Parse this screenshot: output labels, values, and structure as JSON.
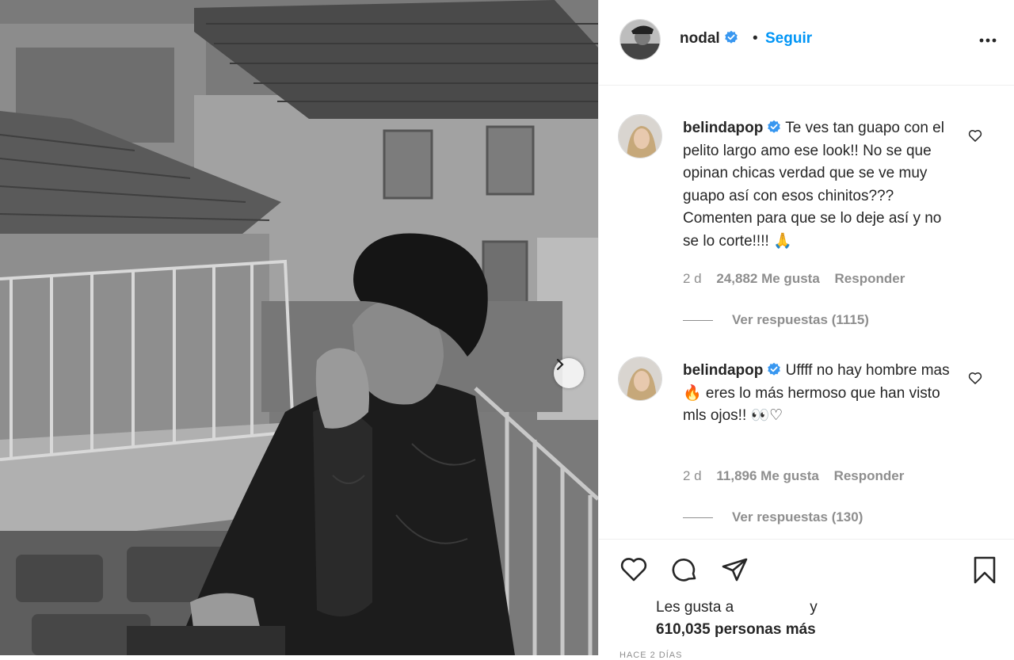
{
  "post": {
    "username": "nodal",
    "separator": "•",
    "follow_label": "Seguir"
  },
  "comments": [
    {
      "username": "belindapop",
      "text": "Te ves tan guapo con el pelito largo amo ese look!! No se que opinan chicas verdad que se ve muy guapo así con esos chinitos??? Comenten para que se lo deje así y no se lo corte!!!! 🙏",
      "time": "2 d",
      "likes": "24,882 Me gusta",
      "reply_label": "Responder",
      "view_replies": "Ver respuestas (1115)"
    },
    {
      "username": "belindapop",
      "text": "Uffff no hay hombre mas 🔥 eres lo más hermoso que han visto mls ojos!! 👀♡",
      "time": "2 d",
      "likes": "11,896 Me gusta",
      "reply_label": "Responder",
      "view_replies": "Ver respuestas (130)"
    }
  ],
  "likes": {
    "prefix": "Les gusta a",
    "conjunction": "y",
    "count_label": "610,035 personas más"
  },
  "posted": "HACE 2 DÍAS",
  "icons": {
    "verified": "verified-badge-icon",
    "more": "more-options-icon",
    "heart": "heart-icon",
    "comment": "comment-icon",
    "share": "share-icon",
    "save": "bookmark-icon",
    "next": "chevron-right-icon"
  },
  "colors": {
    "link_blue": "#0095f6",
    "verified_blue": "#3897f0",
    "text": "#262626",
    "muted": "#8e8e8e"
  }
}
